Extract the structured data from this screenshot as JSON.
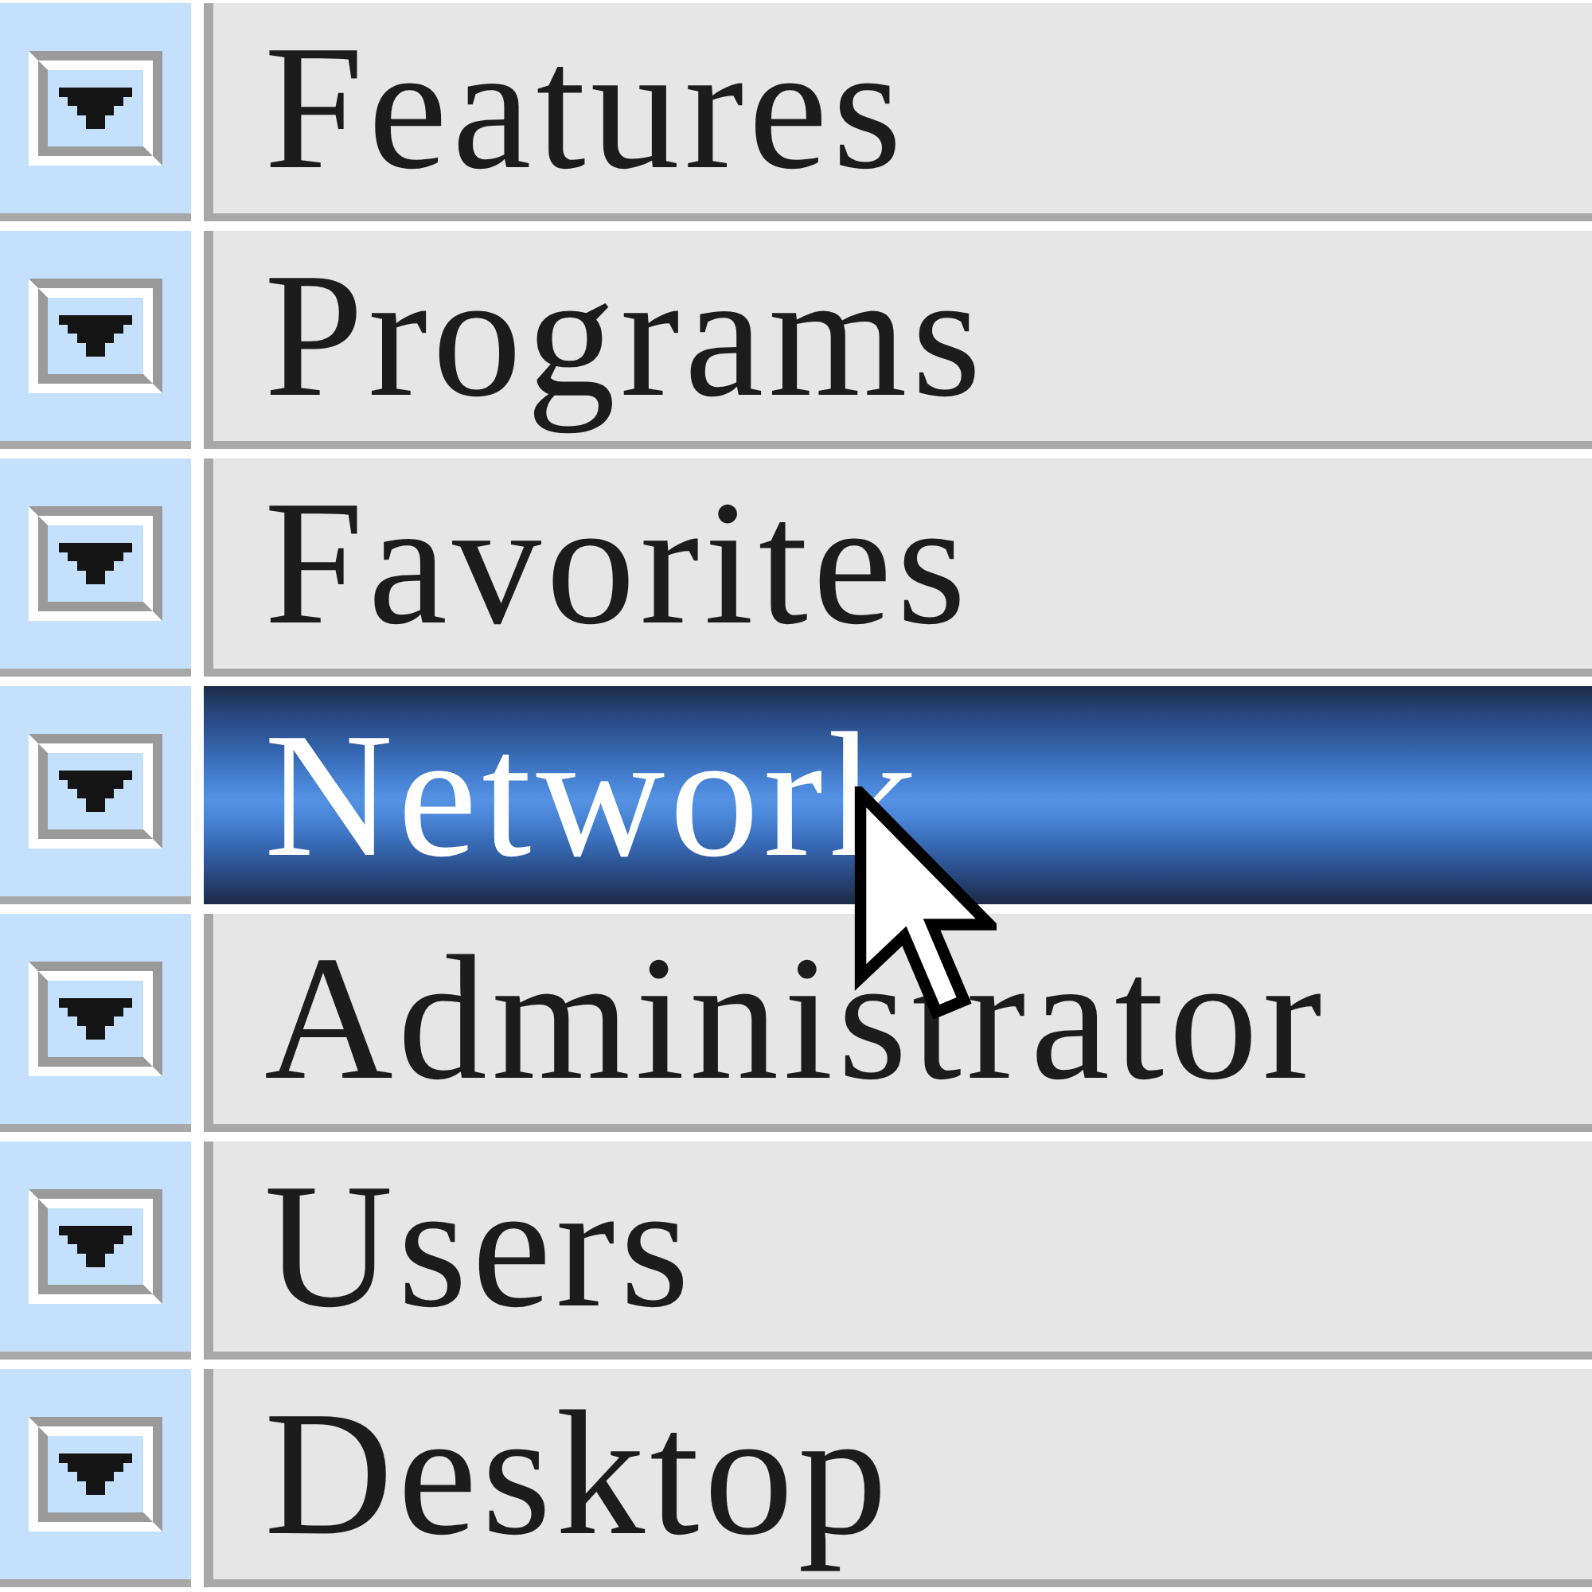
{
  "menu": {
    "items": [
      {
        "label": "Features",
        "selected": false
      },
      {
        "label": "Programs",
        "selected": false
      },
      {
        "label": "Favorites",
        "selected": false
      },
      {
        "label": "Network",
        "selected": true
      },
      {
        "label": "Administrator",
        "selected": false
      },
      {
        "label": "Users",
        "selected": false
      },
      {
        "label": "Desktop",
        "selected": false
      }
    ]
  }
}
